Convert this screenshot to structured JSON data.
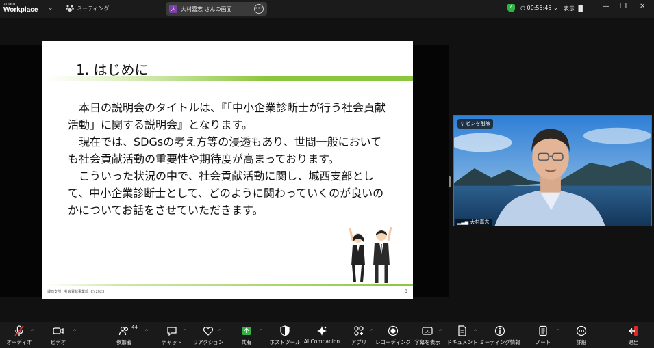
{
  "app": {
    "logo_line1": "zoom",
    "logo_line2": "Workplace",
    "meeting_tab": "ミーティング"
  },
  "share": {
    "presenter_initial": "大",
    "title": "大村嘉志 さんの画面",
    "more_icon": "more-icon"
  },
  "status": {
    "timer": "00:55:45",
    "view_label": "表示"
  },
  "slide": {
    "title": "1. はじめに",
    "paragraphs": [
      "本日の説明会のタイトルは、『「中小企業診断士が行う社会貢献活動」に関する説明会』となります。",
      "現在では、SDGsの考え方等の浸透もあり、世間一般においても社会貢献活動の重要性や期待度が高まっております。",
      "こういった状況の中で、社会貢献活動に関し、城西支部として、中小企業診断士として、どのように関わっていくのが良いのかについてお話をさせていただきます。"
    ],
    "footer": "城西支部　社会貢献事業部 (C) 2023",
    "page": "3"
  },
  "video": {
    "pin_label": "ピンを削除",
    "participant_name": "大村嘉志"
  },
  "toolbar": {
    "audio": "オーディオ",
    "video": "ビデオ",
    "participants": "参加者",
    "participant_count": "44",
    "chat": "チャット",
    "reactions": "リアクション",
    "share": "共有",
    "host_tools": "ホストツール",
    "ai_companion": "AI Companion",
    "apps": "アプリ",
    "recording": "レコーディング",
    "captions": "字幕を表示",
    "docs": "ドキュメント",
    "meeting_info": "ミーティング情報",
    "notes": "ノート",
    "more": "詳細",
    "leave": "退出"
  },
  "colors": {
    "share_green": "#2fb344",
    "leave_red": "#e02828",
    "slide_green": "#8cc63f"
  }
}
